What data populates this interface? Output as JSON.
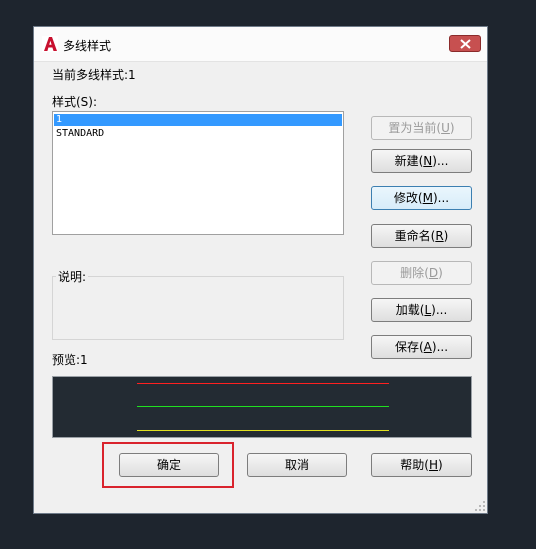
{
  "window": {
    "title": "多线样式",
    "close_icon": "close-icon"
  },
  "current_style": {
    "label": "当前多线样式:",
    "value": "1"
  },
  "styles": {
    "label": "样式(S):",
    "items": [
      "1",
      "STANDARD"
    ],
    "selected_index": 0
  },
  "description": {
    "label": "说明:"
  },
  "preview": {
    "label": "预览:",
    "value": "1",
    "line_colors": [
      "#ff2020",
      "#20e020",
      "#e0e020"
    ]
  },
  "buttons": {
    "set_current": {
      "text": "置为当前",
      "key": "U"
    },
    "new": {
      "text": "新建",
      "key": "N",
      "suffix": "..."
    },
    "modify": {
      "text": "修改",
      "key": "M",
      "suffix": "..."
    },
    "rename": {
      "text": "重命名",
      "key": "R"
    },
    "delete": {
      "text": "删除",
      "key": "D"
    },
    "load": {
      "text": "加载",
      "key": "L",
      "suffix": "..."
    },
    "save": {
      "text": "保存",
      "key": "A",
      "suffix": "..."
    },
    "ok": {
      "text": "确定"
    },
    "cancel": {
      "text": "取消"
    },
    "help": {
      "text": "帮助",
      "key": "H"
    }
  },
  "colors": {
    "highlight": "#d9232d",
    "selection": "#3399ff"
  }
}
